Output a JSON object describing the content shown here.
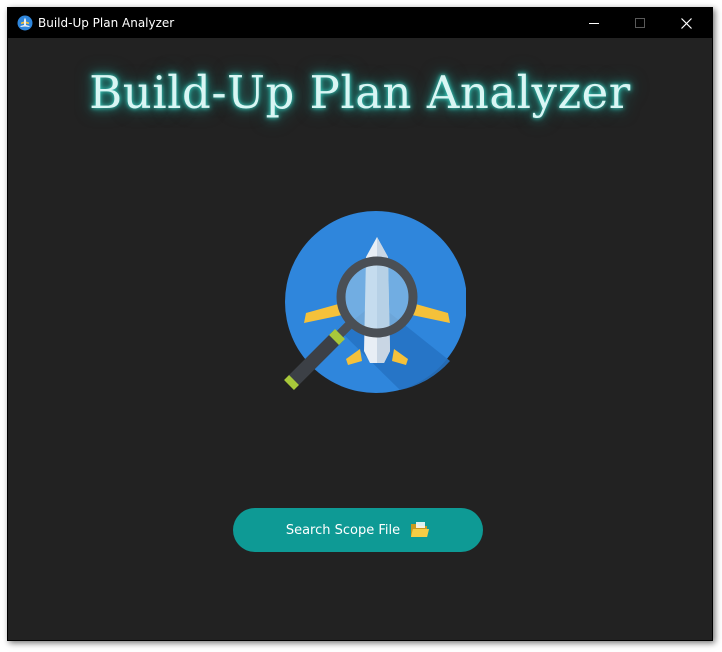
{
  "window": {
    "title": "Build-Up Plan Analyzer",
    "controls": {
      "minimize": "minimize",
      "maximize": "maximize",
      "close": "close"
    }
  },
  "main": {
    "heading": "Build-Up Plan Analyzer",
    "logo_icon": "airplane-magnifier-icon",
    "search_button": {
      "label": "Search Scope File",
      "icon": "folder-icon"
    }
  },
  "colors": {
    "background": "#222222",
    "titlebar": "#000000",
    "heading_glow": "#3fe0d0",
    "button": "#0e9a95",
    "logo_blue": "#2f86dc",
    "wing_yellow": "#f5c13a"
  }
}
